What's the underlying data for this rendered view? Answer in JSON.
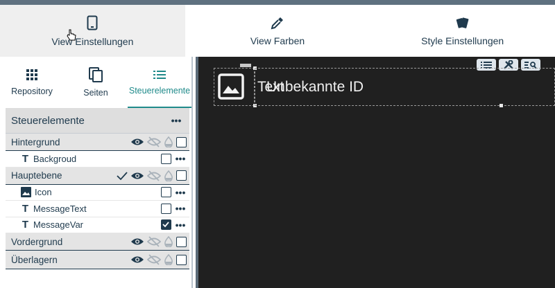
{
  "topnav": {
    "items": [
      {
        "label": "View Einstellungen",
        "icon": "phone-icon",
        "active": true
      },
      {
        "label": "View Farben",
        "icon": "eyedropper-icon",
        "active": false
      },
      {
        "label": "Style Einstellungen",
        "icon": "style-icon",
        "active": false
      }
    ]
  },
  "left_tabs": [
    {
      "label": "Repository",
      "icon": "grid-icon"
    },
    {
      "label": "Seiten",
      "icon": "pages-icon"
    },
    {
      "label": "Steuerelemente",
      "icon": "list-icon",
      "active": true
    }
  ],
  "tree": {
    "title": "Steuerelemente",
    "more_glyph": "•••",
    "groups": [
      {
        "label": "Hintergrund",
        "children": [
          {
            "label": "Backgroud",
            "type": "text",
            "checked": false
          }
        ]
      },
      {
        "label": "Hauptebene",
        "checkmark": true,
        "children": [
          {
            "label": "Icon",
            "type": "image",
            "checked": false
          },
          {
            "label": "MessageText",
            "type": "text",
            "checked": false
          },
          {
            "label": "MessageVar",
            "type": "text",
            "checked": true
          }
        ]
      },
      {
        "label": "Vordergrund",
        "children": []
      },
      {
        "label": "Überlagern",
        "children": []
      }
    ]
  },
  "canvas": {
    "text_overlay_a": "Text",
    "text_overlay_b": "Unbekannte ID",
    "toolbar": [
      "list-icon",
      "tools-icon",
      "search-list-icon"
    ]
  },
  "colors": {
    "primary": "#1f3a4d",
    "accent": "#1f8a8a",
    "canvas_bg": "#202020"
  }
}
